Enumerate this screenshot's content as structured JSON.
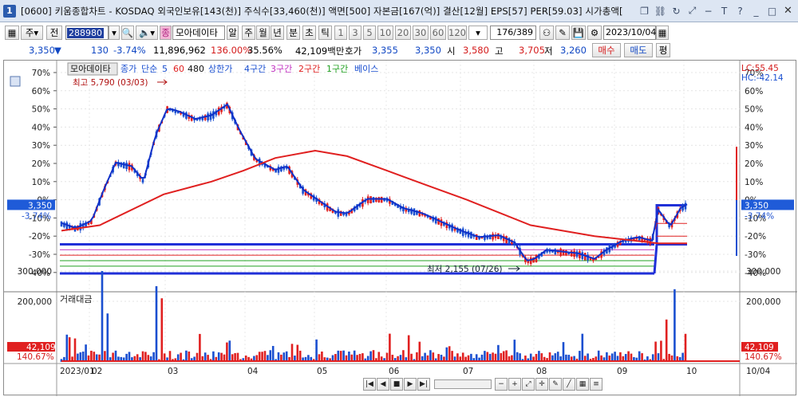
{
  "window": {
    "number": "1",
    "title": "[0600] 키움종합차트 - KOSDAQ 외국인보유[143(천)] 주식수[33,460(천)] 액면[500] 자본금[167(억)] 결산[12월] EPS[57] PER[59.03] 시가총액[",
    "icons": [
      "restore-icon",
      "link-icon",
      "refresh-icon",
      "resize-icon",
      "minus-icon",
      "text-icon",
      "help-icon",
      "minimize-icon",
      "maximize-icon",
      "close-icon"
    ]
  },
  "toolbar": {
    "period_btn_1": "주",
    "period_btn_2": "전",
    "code": "288980",
    "name_button": "종",
    "stock_name": "모아데이타",
    "alarm_btn": "알",
    "tf_week": "주",
    "tf_month": "월",
    "tf_year": "년",
    "tf_min": "분",
    "tf_sec": "초",
    "tf_tick": "틱",
    "nums": [
      "1",
      "3",
      "5",
      "10",
      "20",
      "30",
      "60",
      "120"
    ],
    "period_value": "176/389",
    "date_value": "2023/10/04"
  },
  "quote": {
    "price": "3,350",
    "change": "130",
    "change_pct": "-3.74%",
    "volume": "11,896,962",
    "vol_ratio": "136.00%",
    "turnover": "35.56%",
    "amount": "42,109백만",
    "hoga_label": "호가",
    "hoga": "3,355",
    "ask": "3,350",
    "open_label": "시",
    "open": "3,580",
    "high_label": "고",
    "high": "3,705",
    "low_label": "저",
    "low": "3,260",
    "buy_btn": "매수",
    "sell_btn": "매도",
    "eval_btn": "평"
  },
  "chart_top": {
    "legend_name": "모아데이타",
    "legend_close": "종가",
    "legend_simple": "단순",
    "ma5": "5",
    "ma60": "60",
    "ma480": "480",
    "upper": "상한가",
    "sec4": "4구간",
    "sec3": "3구간",
    "sec2": "2구간",
    "sec1": "1구간",
    "base": "베이스",
    "max_label": "최고 5,790 (03/03)",
    "min_label": "최저 2,155 (07/26)",
    "lc": "LC:55.45",
    "hc": "HC:-42.14",
    "price_tag": "3,350",
    "pct_tag": "-3.74%",
    "y_ticks": [
      "70%",
      "60%",
      "50%",
      "40%",
      "30%",
      "20%",
      "10%",
      "0%",
      "-10%",
      "-20%",
      "-30%",
      "-40%"
    ]
  },
  "chart_bottom": {
    "label": "거래대금",
    "y_ticks": [
      "300,000",
      "200,000"
    ],
    "value_tag": "42,109",
    "pct_tag": "140.67%"
  },
  "x_axis": [
    "2023/01",
    "02",
    "03",
    "04",
    "05",
    "06",
    "07",
    "08",
    "09",
    "10",
    "10/04"
  ],
  "colors": {
    "up": "#e02020",
    "down": "#1a4fd0",
    "ma60": "#e02020",
    "ma5": "#1030c8",
    "base": "#2030d8",
    "sec3": "#c030c0",
    "sec2": "#e02020",
    "sec1": "#20a020"
  }
}
